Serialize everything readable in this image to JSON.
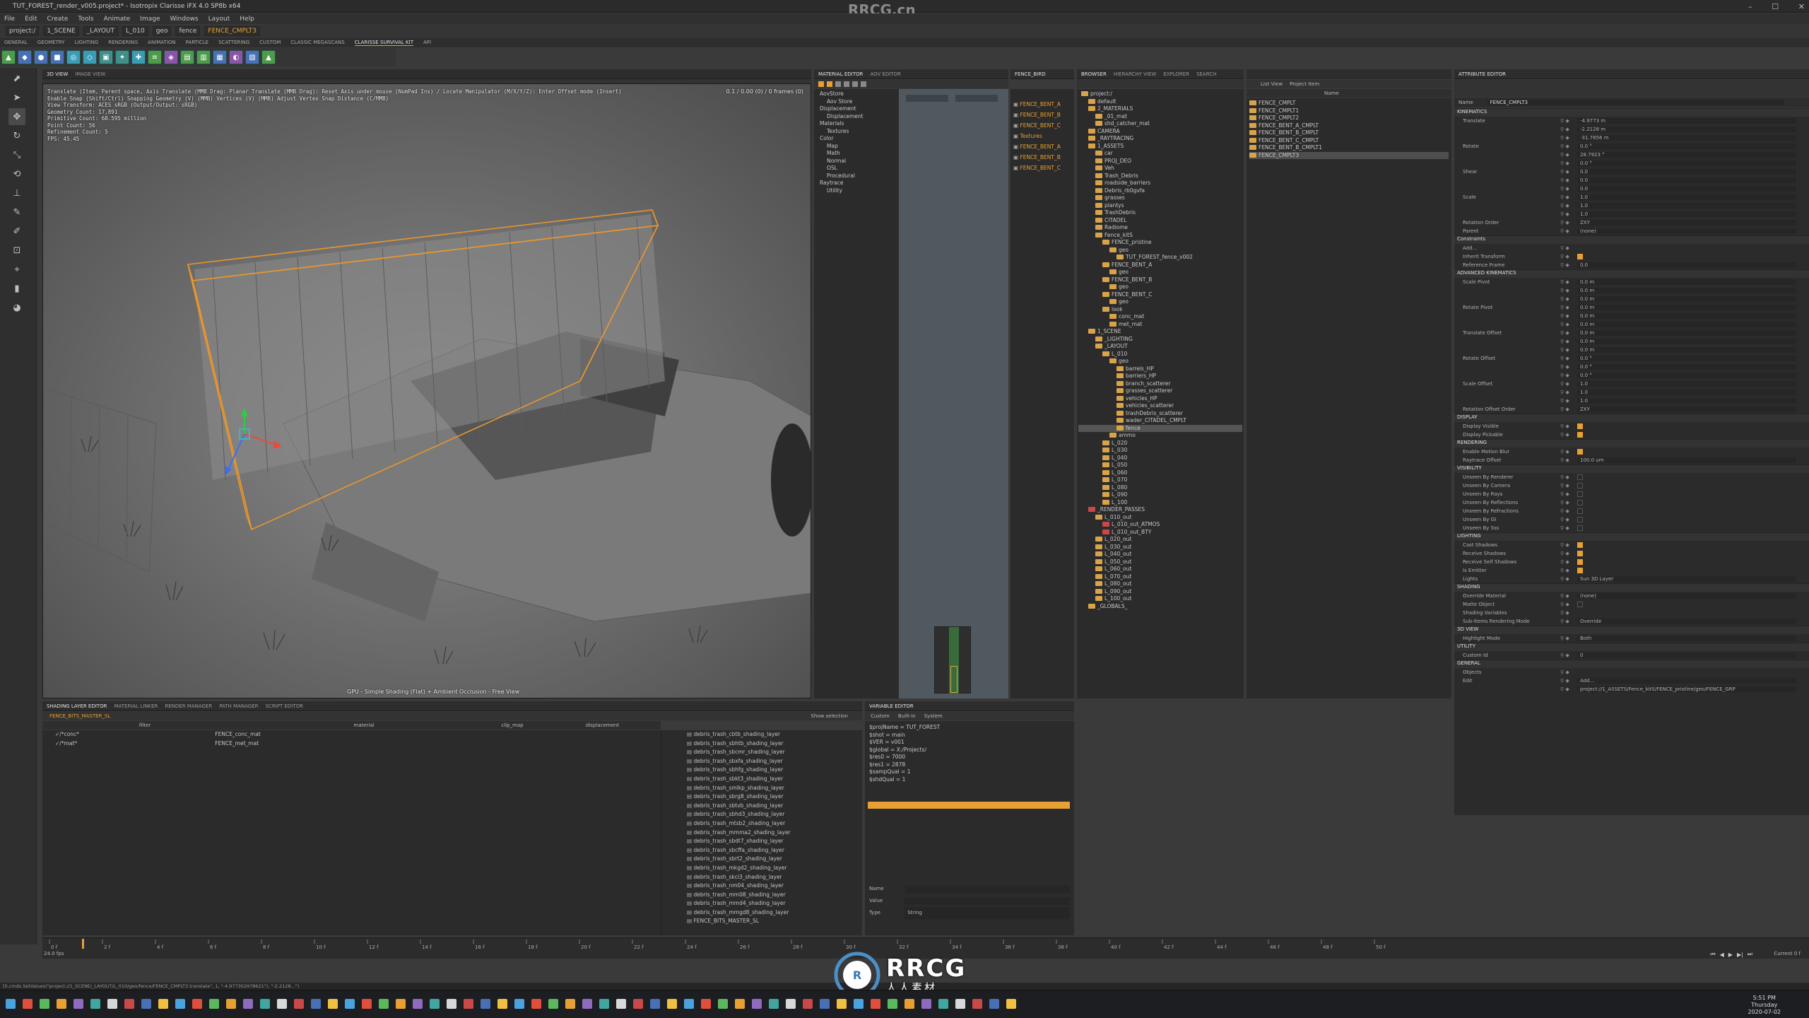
{
  "window": {
    "title": "TUT_FOREST_render_v005.project* - Isotropix Clarisse iFX 4.0 SP8b x64",
    "watermark": "RRCG.cn"
  },
  "menu": [
    "File",
    "Edit",
    "Create",
    "Tools",
    "Animate",
    "Image",
    "Windows",
    "Layout",
    "Help"
  ],
  "path": [
    "project:/",
    "1_SCENE",
    "_LAYOUT",
    "L_010",
    "geo",
    "fence",
    "FENCE_CMPLT3"
  ],
  "shelf_tabs": [
    "GENERAL",
    "GEOMETRY",
    "LIGHTING",
    "RENDERING",
    "ANIMATION",
    "PARTICLE",
    "SCATTERING",
    "CUSTOM",
    "CLASSIC MEGASCANS",
    "CLARISSE SURVIVAL KIT",
    "API"
  ],
  "viewport": {
    "tabs": [
      "3D VIEW",
      "IMAGE VIEW"
    ],
    "hud": [
      "Translate (Item, Parent space, Axis Translate (MMB Drag: Planar Translate (MMB Drag): Reset Axis under mouse (NumPad Ins) / Locate Manipulator (M/X/Y/Z): Enter Offset mode (Insert)",
      "Enable Snap (Shift/Ctrl) Snapping Geometry (V) (MMB) Vertices (V) (MMB) Adjust Vertex Snap Distance (C/MMB)",
      "View Transform: ACES sRGB (Output/Output: sRGB)",
      "Geometry Count: 17,891",
      "Primitive Count: 68.595 million",
      "Point Count: 56",
      "Refinement Count: 5",
      "FPS: 45.45"
    ],
    "top_right": "0.1 / 0.00 (0) / 0 frames (0)",
    "footer": "GPU - Simple Shading (Flat) + Ambient Occlusion - Free View"
  },
  "material_editor": {
    "tabs": [
      "MATERIAL EDITOR",
      "AOV EDITOR"
    ],
    "tree": [
      "AovStore",
      "Aov Store",
      "Displacement",
      "Displacement",
      "Materials",
      "Textures",
      "Color",
      "Map",
      "Math",
      "Normal",
      "OSL",
      "Procedural",
      "Raytrace",
      "Utility"
    ]
  },
  "node_list": [
    "FENCE_BENT_A",
    "FENCE_BENT_B",
    "FENCE_BENT_C",
    "Textures",
    "FENCE_BENT_A",
    "FENCE_BENT_B",
    "FENCE_BENT_C"
  ],
  "browser": {
    "tabs": [
      "BROWSER",
      "HIERARCHY VIEW",
      "EXPLORER",
      "SEARCH"
    ],
    "items": [
      {
        "d": 0,
        "t": "project:/"
      },
      {
        "d": 1,
        "t": "default"
      },
      {
        "d": 1,
        "t": "2_MATERIALS"
      },
      {
        "d": 2,
        "t": "_01_mat"
      },
      {
        "d": 2,
        "t": "shd_catcher_mat"
      },
      {
        "d": 1,
        "t": "CAMERA"
      },
      {
        "d": 1,
        "t": "_RAYTRACING"
      },
      {
        "d": 1,
        "t": "1_ASSETS"
      },
      {
        "d": 2,
        "t": "car"
      },
      {
        "d": 2,
        "t": "PROJ_DEO"
      },
      {
        "d": 2,
        "t": "Veh"
      },
      {
        "d": 2,
        "t": "Trash_Debris"
      },
      {
        "d": 2,
        "t": "roadside_barriers"
      },
      {
        "d": 2,
        "t": "Debris_rb0gvfa"
      },
      {
        "d": 2,
        "t": "grasses"
      },
      {
        "d": 2,
        "t": "plantys"
      },
      {
        "d": 2,
        "t": "TrashDebris"
      },
      {
        "d": 2,
        "t": "CITADEL"
      },
      {
        "d": 2,
        "t": "Radiome"
      },
      {
        "d": 2,
        "t": "Fence_kitS"
      },
      {
        "d": 3,
        "t": "FENCE_pristine"
      },
      {
        "d": 4,
        "t": "geo"
      },
      {
        "d": 5,
        "t": "TUT_FOREST_fence_v002"
      },
      {
        "d": 3,
        "t": "FENCE_BENT_A"
      },
      {
        "d": 4,
        "t": "geo"
      },
      {
        "d": 3,
        "t": "FENCE_BENT_B"
      },
      {
        "d": 4,
        "t": "geo"
      },
      {
        "d": 3,
        "t": "FENCE_BENT_C"
      },
      {
        "d": 4,
        "t": "geo"
      },
      {
        "d": 3,
        "t": "look"
      },
      {
        "d": 4,
        "t": "conc_mat"
      },
      {
        "d": 4,
        "t": "met_mat"
      },
      {
        "d": 1,
        "t": "1_SCENE"
      },
      {
        "d": 2,
        "t": "_LIGHTING"
      },
      {
        "d": 2,
        "t": "_LAYOUT"
      },
      {
        "d": 3,
        "t": "L_010"
      },
      {
        "d": 4,
        "t": "geo"
      },
      {
        "d": 5,
        "t": "barrels_HP"
      },
      {
        "d": 5,
        "t": "barriers_HP"
      },
      {
        "d": 5,
        "t": "branch_scatterer"
      },
      {
        "d": 5,
        "t": "grasses_scatterer"
      },
      {
        "d": 5,
        "t": "vehicles_HP"
      },
      {
        "d": 5,
        "t": "vehicles_scatterer"
      },
      {
        "d": 5,
        "t": "trashDebris_scatterer"
      },
      {
        "d": 5,
        "t": "wader_CITADEL_CMPLT"
      },
      {
        "d": 5,
        "t": "fence"
      },
      {
        "d": 4,
        "t": "ammo"
      },
      {
        "d": 3,
        "t": "L_020"
      },
      {
        "d": 3,
        "t": "L_030"
      },
      {
        "d": 3,
        "t": "L_040"
      },
      {
        "d": 3,
        "t": "L_050"
      },
      {
        "d": 3,
        "t": "L_060"
      },
      {
        "d": 3,
        "t": "L_070"
      },
      {
        "d": 3,
        "t": "L_080"
      },
      {
        "d": 3,
        "t": "L_090"
      },
      {
        "d": 3,
        "t": "L_100"
      },
      {
        "d": 1,
        "t": "_RENDER_PASSES"
      },
      {
        "d": 2,
        "t": "L_010_out"
      },
      {
        "d": 3,
        "t": "L_010_out_ATMOS"
      },
      {
        "d": 3,
        "t": "L_010_out_BTY"
      },
      {
        "d": 2,
        "t": "L_020_out"
      },
      {
        "d": 2,
        "t": "L_030_out"
      },
      {
        "d": 2,
        "t": "L_040_out"
      },
      {
        "d": 2,
        "t": "L_050_out"
      },
      {
        "d": 2,
        "t": "L_060_out"
      },
      {
        "d": 2,
        "t": "L_070_out"
      },
      {
        "d": 2,
        "t": "L_080_out"
      },
      {
        "d": 2,
        "t": "L_090_out"
      },
      {
        "d": 2,
        "t": "L_100_out"
      },
      {
        "d": 1,
        "t": "_GLOBALS_"
      }
    ]
  },
  "list_view": {
    "mode": "List View",
    "filter": "Project Item",
    "header": "Name",
    "items": [
      "FENCE_CMPLT",
      "FENCE_CMPLT1",
      "FENCE_CMPLT2",
      "FENCE_BENT_A_CMPLT",
      "FENCE_BENT_B_CMPLT",
      "FENCE_BENT_C_CMPLT",
      "FENCE_BENT_B_CMPLT1",
      "FENCE_CMPLT3"
    ]
  },
  "attributes": {
    "tab": "ATTRIBUTE EDITOR",
    "name_label": "Name",
    "name": "FENCE_CMPLT3",
    "rows": [
      {
        "s": "KINEMATICS"
      },
      {
        "l": "Translate",
        "v": "-4.9773 m"
      },
      {
        "l": "",
        "v": "-2.2128 m"
      },
      {
        "l": "",
        "v": "-31.7656 m"
      },
      {
        "l": "Rotate",
        "v": "0.0 °"
      },
      {
        "l": "",
        "v": "28.7923 °"
      },
      {
        "l": "",
        "v": "0.0 °"
      },
      {
        "l": "Shear",
        "v": "0.0"
      },
      {
        "l": "",
        "v": "0.0"
      },
      {
        "l": "",
        "v": "0.0"
      },
      {
        "l": "Scale",
        "v": "1.0"
      },
      {
        "l": "",
        "v": "1.0"
      },
      {
        "l": "",
        "v": "1.0"
      },
      {
        "l": "Rotation Order",
        "v": "ZXY"
      },
      {
        "l": "Parent",
        "v": "(none)"
      },
      {
        "s": "Constraints"
      },
      {
        "l": "Add...",
        "v": ""
      },
      {
        "l": "Inherit Transform",
        "v": "",
        "c": true
      },
      {
        "l": "Reference Frame",
        "v": "0.0"
      },
      {
        "s": "ADVANCED KINEMATICS"
      },
      {
        "l": "Scale Pivot",
        "v": "0.0 m"
      },
      {
        "l": "",
        "v": "0.0 m"
      },
      {
        "l": "",
        "v": "0.0 m"
      },
      {
        "l": "Rotate Pivot",
        "v": "0.0 m"
      },
      {
        "l": "",
        "v": "0.0 m"
      },
      {
        "l": "",
        "v": "0.0 m"
      },
      {
        "l": "Translate Offset",
        "v": "0.0 m"
      },
      {
        "l": "",
        "v": "0.0 m"
      },
      {
        "l": "",
        "v": "0.0 m"
      },
      {
        "l": "Rotate Offset",
        "v": "0.0 °"
      },
      {
        "l": "",
        "v": "0.0 °"
      },
      {
        "l": "",
        "v": "0.0 °"
      },
      {
        "l": "Scale Offset",
        "v": "1.0"
      },
      {
        "l": "",
        "v": "1.0"
      },
      {
        "l": "",
        "v": "1.0"
      },
      {
        "l": "Rotation Offset Order",
        "v": "ZXY"
      },
      {
        "s": "DISPLAY"
      },
      {
        "l": "Display Visible",
        "v": "",
        "c": true
      },
      {
        "l": "Display Pickable",
        "v": "",
        "c": true
      },
      {
        "s": "RENDERING"
      },
      {
        "l": "Enable Motion Blur",
        "v": "",
        "c": true
      },
      {
        "l": "Raytrace Offset",
        "v": "100.0 um"
      },
      {
        "s": "VISIBILITY"
      },
      {
        "l": "Unseen By Renderer",
        "v": "",
        "c": false
      },
      {
        "l": "Unseen By Camera",
        "v": "",
        "c": false
      },
      {
        "l": "Unseen By Rays",
        "v": "",
        "c": false
      },
      {
        "l": "Unseen By Reflections",
        "v": "",
        "c": false
      },
      {
        "l": "Unseen By Refractions",
        "v": "",
        "c": false
      },
      {
        "l": "Unseen By GI",
        "v": "",
        "c": false
      },
      {
        "l": "Unseen By Sss",
        "v": "",
        "c": false
      },
      {
        "s": "LIGHTING"
      },
      {
        "l": "Cast Shadows",
        "v": "",
        "c": true
      },
      {
        "l": "Receive Shadows",
        "v": "",
        "c": true
      },
      {
        "l": "Receive Self Shadows",
        "v": "",
        "c": true
      },
      {
        "l": "Is Emitter",
        "v": "",
        "c": true
      },
      {
        "l": "Lights",
        "v": "Sun 3D Layer"
      },
      {
        "s": "SHADING"
      },
      {
        "l": "Override Material",
        "v": "(none)"
      },
      {
        "l": "Matte Object",
        "v": "",
        "c": false
      },
      {
        "l": "Shading Variables",
        "v": ""
      },
      {
        "l": "Sub-Items Rendering Mode",
        "v": "Override"
      },
      {
        "s": "3D VIEW"
      },
      {
        "l": "Highlight Mode",
        "v": "Both"
      },
      {
        "s": "UTILITY"
      },
      {
        "l": "Custom Id",
        "v": "0"
      },
      {
        "s": "GENERAL"
      },
      {
        "l": "Objects",
        "v": ""
      },
      {
        "l": "Edit",
        "v": "Add..."
      },
      {
        "l": "",
        "v": "project://1_ASSETS/Fence_kitS/FENCE_pristine/geo/FENCE_GRP"
      }
    ]
  },
  "layer_editor": {
    "tabs": [
      "SHADING LAYER EDITOR",
      "MATERIAL LINKER",
      "RENDER MANAGER",
      "PATH MANAGER",
      "SCRIPT EDITOR"
    ],
    "context": "FENCE_BITS_MASTER_SL",
    "show_selection": "Show selection",
    "headers": [
      "filter",
      "material",
      "clip_map",
      "displacement"
    ],
    "rows": [
      {
        "f": "/*conc*",
        "m": "FENCE_conc_mat"
      },
      {
        "f": "/*mat*",
        "m": "FENCE_met_mat"
      }
    ],
    "list": [
      "debris_trash_cbtb_shading_layer",
      "debris_trash_sbhtb_shading_layer",
      "debris_trash_sbcmr_shading_layer",
      "debris_trash_sbxfa_shading_layer",
      "debris_trash_sbhfg_shading_layer",
      "debris_trash_sbkt3_shading_layer",
      "debris_trash_smlkp_shading_layer",
      "debris_trash_sbrg8_shading_layer",
      "debris_trash_sbtvb_shading_layer",
      "debris_trash_sbhd3_shading_layer",
      "debris_trash_mtsb2_shading_layer",
      "debris_trash_mmma2_shading_layer",
      "debris_trash_sbdt7_shading_layer",
      "debris_trash_sbcffa_shading_layer",
      "debris_trash_sbrt2_shading_layer",
      "debris_trash_mkgd2_shading_layer",
      "debris_trash_skci3_shading_layer",
      "debris_trash_nm04_shading_layer",
      "debris_trash_mm08_shading_layer",
      "debris_trash_mmd4_shading_layer",
      "debris_trash_mmgd8_shading_layer",
      "FENCE_BITS_MASTER_SL"
    ]
  },
  "variable_editor": {
    "tab": "VARIABLE EDITOR",
    "sub": [
      "Custom",
      "Built-in",
      "System"
    ],
    "vars": [
      "$projName = TUT_FOREST",
      "$shot = main",
      "$VER = v001",
      "$global = X:/Projects/",
      "$res0 = 7000",
      "$res1 = 2878",
      "$sampQual = 1",
      "$shdQual = 1"
    ],
    "name_label": "Name",
    "value_label": "Value",
    "type_label": "Type",
    "type_value": "String"
  },
  "timeline": {
    "ticks": [
      "0 f",
      "2 f",
      "4 f",
      "6 f",
      "8 f",
      "10 f",
      "12 f",
      "14 f",
      "16 f",
      "18 f",
      "20 f",
      "22 f",
      "24 f",
      "26 f",
      "28 f",
      "30 f",
      "32 f",
      "34 f",
      "36 f",
      "38 f",
      "40 f",
      "42 f",
      "44 f",
      "46 f",
      "48 f",
      "50 f"
    ],
    "current": "Current 0 f",
    "start": "24.0 fps"
  },
  "status": "[0.cmds.SetValues(\"project://1_SCENE/_LAYOUT/L_010/geo/fence/FENCE_CMPLT3.translate\", 1, \"-4.977302978621\"), \"-2.2128...\")",
  "taskbar": {
    "time": "5:51 PM",
    "date": "2020-07-02",
    "day": "Thursday"
  },
  "brand": {
    "logo": "RRCG",
    "sub": "人人素材"
  }
}
